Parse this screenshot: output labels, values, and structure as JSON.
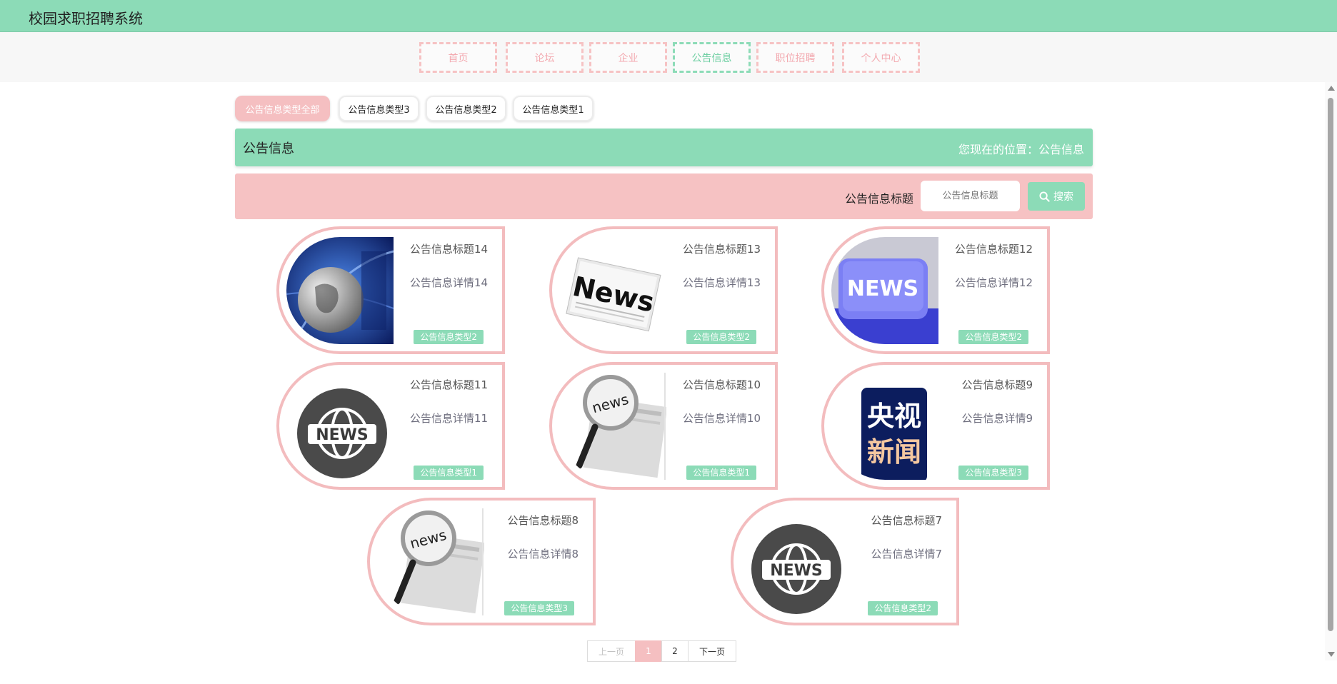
{
  "app": {
    "title": "校园求职招聘系统"
  },
  "nav": {
    "items": [
      {
        "label": "首页"
      },
      {
        "label": "论坛"
      },
      {
        "label": "企业"
      },
      {
        "label": "公告信息"
      },
      {
        "label": "职位招聘"
      },
      {
        "label": "个人中心"
      }
    ],
    "active_index": 3
  },
  "type_tabs": [
    {
      "label": "公告信息类型全部"
    },
    {
      "label": "公告信息类型3"
    },
    {
      "label": "公告信息类型2"
    },
    {
      "label": "公告信息类型1"
    }
  ],
  "section": {
    "title": "公告信息",
    "breadcrumb": "您现在的位置：公告信息"
  },
  "search": {
    "label": "公告信息标题",
    "placeholder": "公告信息标题",
    "button": "搜索"
  },
  "cards": [
    {
      "title": "公告信息标题14",
      "detail": "公告信息详情14",
      "type": "公告信息类型2",
      "image": "globe-news-image"
    },
    {
      "title": "公告信息标题13",
      "detail": "公告信息详情13",
      "type": "公告信息类型2",
      "image": "newspaper-image",
      "image_text": "News"
    },
    {
      "title": "公告信息标题12",
      "detail": "公告信息详情12",
      "type": "公告信息类型2",
      "image": "news-key-image",
      "image_text": "NEWS"
    },
    {
      "title": "公告信息标题11",
      "detail": "公告信息详情11",
      "type": "公告信息类型1",
      "image": "globe-news-icon-image",
      "image_text": "NEWS"
    },
    {
      "title": "公告信息标题10",
      "detail": "公告信息详情10",
      "type": "公告信息类型1",
      "image": "magnifier-news-image",
      "image_text": "news"
    },
    {
      "title": "公告信息标题9",
      "detail": "公告信息详情9",
      "type": "公告信息类型3",
      "image": "cctv-news-logo-image",
      "image_text": "央视新闻"
    },
    {
      "title": "公告信息标题8",
      "detail": "公告信息详情8",
      "type": "公告信息类型3",
      "image": "magnifier-news-image",
      "image_text": "news"
    },
    {
      "title": "公告信息标题7",
      "detail": "公告信息详情7",
      "type": "公告信息类型2",
      "image": "globe-news-icon-image",
      "image_text": "NEWS"
    }
  ],
  "pagination": {
    "prev": "上一页",
    "pages": [
      "1",
      "2"
    ],
    "current": "1",
    "next": "下一页"
  },
  "colors": {
    "mint": "#8cdbb7",
    "pink": "#f6c2c3",
    "pink_border": "#f3bcbe"
  }
}
